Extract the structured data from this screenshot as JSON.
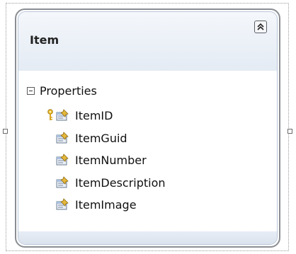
{
  "entity": {
    "title": "Item",
    "collapse_icon": "double-chevron-up-icon"
  },
  "section": {
    "label": "Properties",
    "toggle_icon": "minus-box-icon"
  },
  "properties": [
    {
      "label": "ItemID",
      "is_key": true,
      "icon": "property-icon"
    },
    {
      "label": "ItemGuid",
      "is_key": false,
      "icon": "property-icon"
    },
    {
      "label": "ItemNumber",
      "is_key": false,
      "icon": "property-icon"
    },
    {
      "label": "ItemDescription",
      "is_key": false,
      "icon": "property-icon"
    },
    {
      "label": "ItemImage",
      "is_key": false,
      "icon": "property-icon"
    }
  ],
  "colors": {
    "border": "#8a8d92",
    "header_gradient_top": "#f4f7fb",
    "header_gradient_bottom": "#e4ebf4",
    "key_icon": "#e2b32c"
  }
}
